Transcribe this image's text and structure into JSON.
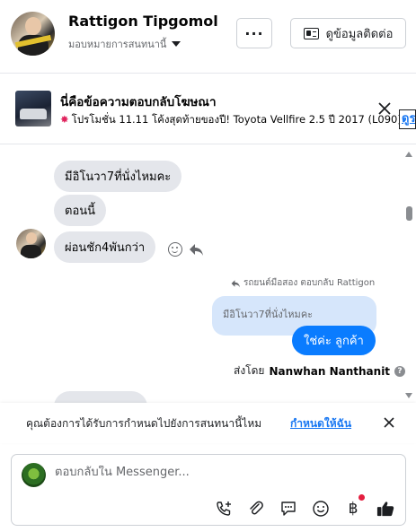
{
  "header": {
    "name": "Rattigon Tipgomol",
    "assign_label": "มอบหมายการสนทนานี้",
    "more_label": "···",
    "contact_label": "ดูข้อมูลติดต่อ"
  },
  "ad": {
    "title": "นี่คือข้อความตอบกลับโฆษณา",
    "subtitle": "โปรโมชั่น 11.11 โค้งสุดท้ายของปี! Toyota Vellfire 2.5 ปี 2017 (L090) ...",
    "link_label": "ดูรา"
  },
  "messages": {
    "in_1": "มีอิโนวา7ที่นั่งไหมคะ",
    "in_2": "ตอนนี้",
    "in_3": "ผ่อนชัก4พันกว่า",
    "reply_meta": "รถยนต์มือสอง ตอบกลับ Rattigon",
    "quoted": "มีอิโนวา7ที่นั่งไหมคะ",
    "out_1": "ใช่ค่ะ  ลูกค้า",
    "sent_by_prefix": "ส่งโดย",
    "sent_by_name": "Nanwhan Nanthanit",
    "info_glyph": "?"
  },
  "prompt": {
    "text": "คุณต้องการได้รับการกำหนดไปยังการสนทนานี้ไหม",
    "link": "กำหนดให้ฉัน"
  },
  "composer": {
    "placeholder": "ตอบกลับใน Messenger...",
    "currency_glyph": "฿"
  },
  "colors": {
    "accent": "#0a7cff",
    "link": "#1877f2",
    "incoming_bubble": "#e4e6eb",
    "quoted_bubble": "#d6e6fb",
    "notification_dot": "#e41e3f"
  },
  "icons": [
    "more-icon",
    "contact-card-icon",
    "close-icon",
    "reaction-icon",
    "reply-icon",
    "info-icon",
    "call-add-icon",
    "attach-icon",
    "saved-reply-icon",
    "emoji-icon",
    "currency-icon",
    "thumbs-up-icon"
  ]
}
